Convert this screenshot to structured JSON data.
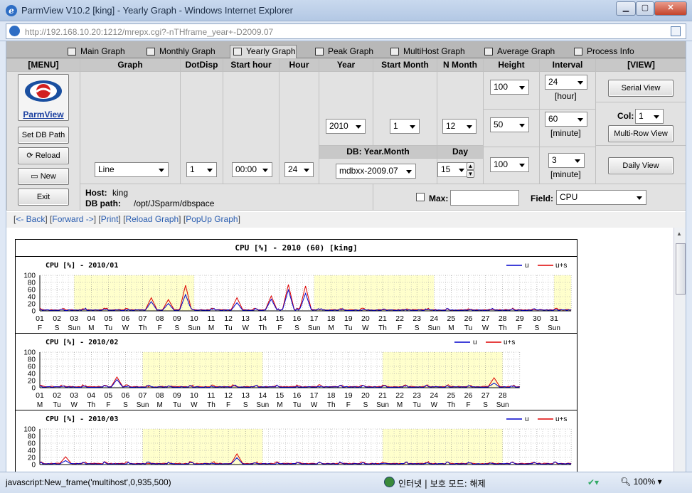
{
  "window": {
    "title": "ParmView V10.2 [king] - Yearly Graph - Windows Internet Explorer"
  },
  "address": {
    "url_host": "http://192.168.10.20",
    "url_rest": ":1212/mrepx.cgi?-nTHframe_year+-D2009.07"
  },
  "tabs": [
    "Main Graph",
    "Monthly Graph",
    "Yearly Graph",
    "Peak Graph",
    "MultiHost Graph",
    "Average Graph",
    "Process Info"
  ],
  "active_tab": "Yearly Graph",
  "headers": {
    "menu": "[MENU]",
    "graph": "Graph",
    "dotdisp": "DotDisp",
    "starthour": "Start hour",
    "hour": "Hour",
    "year": "Year",
    "startmonth": "Start Month",
    "nmonth": "N Month",
    "height": "Height",
    "interval": "Interval",
    "view": "[VIEW]"
  },
  "menu": {
    "logo": "ParmView",
    "setdb": "Set DB Path",
    "reload": "Reload",
    "new": "New",
    "exit": "Exit"
  },
  "controls": {
    "graph": "Line",
    "dotdisp": "1",
    "starthour": "00:00",
    "hour": "24",
    "year": "2010",
    "startmonth": "1",
    "nmonth": "12",
    "height1": "100",
    "height2": "50",
    "height3": "100",
    "interval1": "24",
    "interval1_unit": "[hour]",
    "interval2": "60",
    "interval2_unit": "[minute]",
    "interval3": "3",
    "interval3_unit": "[minute]",
    "db_label": "DB: Year.Month",
    "db_value": "mdbxx-2009.07",
    "day_label": "Day",
    "day_value": "15",
    "serial": "Serial View",
    "col_label": "Col:",
    "col_value": "1",
    "multirow": "Multi-Row View",
    "daily": "Daily View",
    "host_label": "Host:",
    "host": "king",
    "dbpath_label": "DB path:",
    "dbpath": "/opt/JSparm/dbspace",
    "max_label": "Max:",
    "field_label": "Field:",
    "field": "CPU"
  },
  "links": {
    "back": "<- Back",
    "forward": "Forward ->",
    "print": "Print",
    "reload": "Reload Graph",
    "popup": "PopUp Graph"
  },
  "graph_title": "CPU [%] - 2010 (60) [king]",
  "legend": {
    "u": "u",
    "us": "u+s"
  },
  "colors": {
    "u": "#0000cc",
    "us": "#dd0000",
    "weekend": "#ffffcc"
  },
  "chart_data": {
    "type": "line",
    "ylim": [
      0,
      100
    ],
    "yticks": [
      0,
      20,
      40,
      60,
      80,
      100
    ],
    "months": [
      {
        "title": "CPU [%] - 2010/01",
        "days": 31,
        "dows": [
          "F",
          "S",
          "Sun",
          "M",
          "Tu",
          "W",
          "Th",
          "F",
          "S",
          "Sun",
          "M",
          "Tu",
          "W",
          "Th",
          "F",
          "S",
          "Sun",
          "M",
          "Tu",
          "W",
          "Th",
          "F",
          "S",
          "Sun",
          "M",
          "Tu",
          "W",
          "Th",
          "F",
          "S",
          "Sun"
        ],
        "weekend_spans": [
          [
            3,
            10
          ],
          [
            17,
            24
          ],
          [
            31,
            32
          ]
        ],
        "peaks_u": [
          [
            7,
            25
          ],
          [
            8,
            20
          ],
          [
            9,
            45
          ],
          [
            12,
            22
          ],
          [
            14,
            32
          ],
          [
            15,
            58
          ],
          [
            16,
            48
          ]
        ],
        "peaks_us": [
          [
            7,
            35
          ],
          [
            8,
            30
          ],
          [
            9,
            70
          ],
          [
            12,
            35
          ],
          [
            14,
            40
          ],
          [
            15,
            72
          ],
          [
            16,
            68
          ]
        ]
      },
      {
        "title": "CPU [%] - 2010/02",
        "days": 28,
        "dows": [
          "M",
          "Tu",
          "W",
          "Th",
          "F",
          "S",
          "Sun",
          "M",
          "Tu",
          "W",
          "Th",
          "F",
          "S",
          "Sun",
          "M",
          "Tu",
          "W",
          "Th",
          "F",
          "S",
          "Sun",
          "M",
          "Tu",
          "W",
          "Th",
          "F",
          "S",
          "Sun"
        ],
        "weekend_spans": [
          [
            7,
            14
          ],
          [
            21,
            28
          ]
        ],
        "peaks_u": [
          [
            5,
            22
          ],
          [
            27,
            12
          ]
        ],
        "peaks_us": [
          [
            5,
            28
          ],
          [
            27,
            26
          ]
        ]
      },
      {
        "title": "CPU [%] - 2010/03",
        "days": 31,
        "dows": [],
        "weekend_spans": [
          [
            7,
            14
          ],
          [
            21,
            28
          ]
        ],
        "peaks_u": [
          [
            2,
            10
          ],
          [
            12,
            18
          ]
        ],
        "peaks_us": [
          [
            2,
            20
          ],
          [
            12,
            28
          ]
        ]
      }
    ]
  },
  "status": {
    "text": "javascript:New_frame('multihost',0,935,500)",
    "zone": "인터넷 | 보호 모드: 해제",
    "zoom": "100%"
  }
}
